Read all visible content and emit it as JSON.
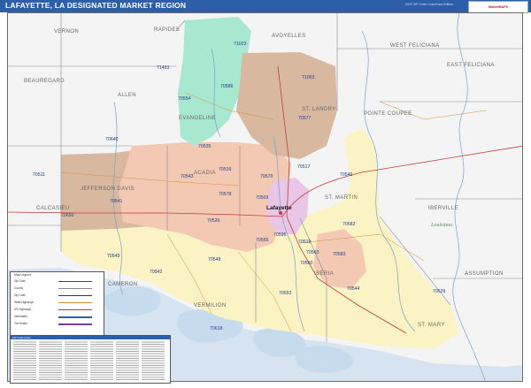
{
  "header": {
    "title": "LAFAYETTE, LA DESIGNATED MARKET REGION",
    "edition": "2022 ZIP Code Color/Cast Edition",
    "brand": "MarketMAPS"
  },
  "parishes": [
    {
      "name": "VERNON"
    },
    {
      "name": "RAPIDES"
    },
    {
      "name": "AVOYELLES"
    },
    {
      "name": "WEST FELICIANA"
    },
    {
      "name": "EAST FELICIANA"
    },
    {
      "name": "BEAUREGARD"
    },
    {
      "name": "ALLEN"
    },
    {
      "name": "EVANGELINE"
    },
    {
      "name": "POINTE COUPEE"
    },
    {
      "name": "ST. LANDRY"
    },
    {
      "name": "JEFFERSON DAVIS"
    },
    {
      "name": "ACADIA"
    },
    {
      "name": "CALCASIEU"
    },
    {
      "name": "ST. MARTIN"
    },
    {
      "name": "IBERVILLE"
    },
    {
      "name": "CAMERON"
    },
    {
      "name": "VERMILION"
    },
    {
      "name": "IBERIA"
    },
    {
      "name": "ASSUMPTION"
    },
    {
      "name": "ST. MARY"
    }
  ],
  "cities": [
    {
      "name": "Lafayette"
    }
  ],
  "water_labels": [
    {
      "name": "Louisiana"
    }
  ],
  "zips": [
    "71023",
    "71003",
    "71463",
    "70586",
    "70554",
    "70577",
    "70640",
    "70535",
    "70516",
    "70543",
    "70511",
    "70541",
    "70570",
    "70526",
    "70578",
    "70503",
    "70517",
    "70582",
    "70555",
    "70548",
    "70650",
    "70549",
    "70542",
    "70563",
    "70560",
    "70553",
    "70544",
    "70539",
    "70519",
    "70596",
    "70583",
    "70546",
    "70618"
  ],
  "legend": {
    "title": "Map Legend",
    "rows": [
      "Zip Code",
      "County",
      "Zip Code",
      "State Highways",
      "US Highways",
      "Interstates",
      "Toll Roads"
    ]
  },
  "index": {
    "title": "ZIP Code Index"
  },
  "colors": {
    "header": "#2d5ea8",
    "zone_teal": "#a8e8d0",
    "zone_tan": "#d8b9a0",
    "zone_pink": "#f3c9b4",
    "zone_yellow": "#fbf3c3",
    "zone_purple": "#e7c6e6",
    "water": "#cfe0f1",
    "zip_text": "#1e3d8c"
  }
}
